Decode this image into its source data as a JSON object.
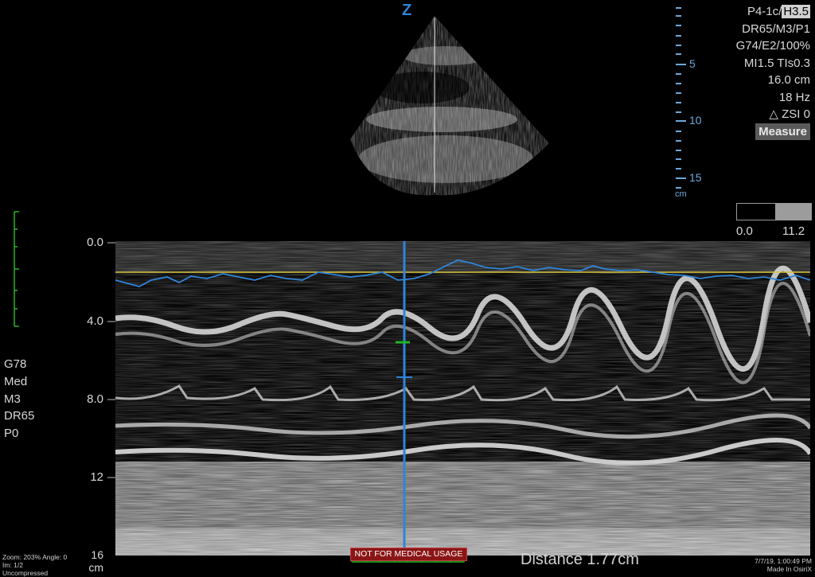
{
  "header": {
    "probe_icon": "Z",
    "params": [
      "P4-1c/",
      "H3.5",
      "DR65/M3/P1",
      "G74/E2/100%",
      "MI1.5  TIs0.3",
      "16.0 cm",
      "18 Hz",
      "ZSI 0"
    ],
    "measure_label": "Measure"
  },
  "depth_ruler": {
    "labels": [
      "5",
      "10",
      "15"
    ],
    "unit": "cm"
  },
  "gray_scale": {
    "min": "0.0",
    "max": "11.2"
  },
  "mmode": {
    "depth_labels": [
      "0.0",
      "4.0",
      "8.0",
      "12",
      "16"
    ],
    "unit": "cm"
  },
  "left_params": [
    "G78",
    "Med",
    "M3",
    "DR65",
    "P0"
  ],
  "footer": {
    "left": [
      "Zoom: 203%  Angle: 0",
      "Im: 1/2",
      "Uncompressed"
    ],
    "right": [
      "7/7/19, 1:00:49 PM",
      "Made In OsiriX"
    ],
    "warning": "NOT FOR MEDICAL USAGE",
    "distance": "Distance 1.77cm"
  },
  "colors": {
    "accent_blue": "#2f84d8",
    "trace_yellow": "#d6c23a",
    "caliper_green": "#22b522",
    "warning_red": "#8b1515"
  }
}
